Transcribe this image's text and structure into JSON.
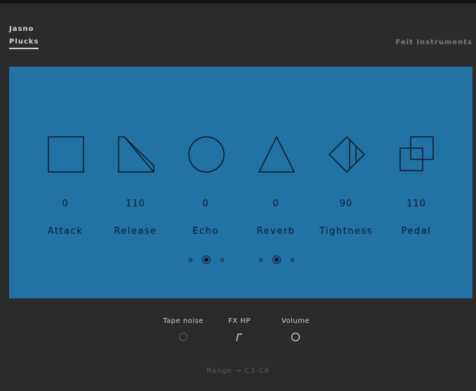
{
  "header": {
    "brand": "Jasno",
    "preset": "Plucks",
    "vendor": "Felt Instruments"
  },
  "panel": {
    "background": "#2372a6",
    "controls": [
      {
        "label": "Attack",
        "value": "0",
        "icon": "square-icon"
      },
      {
        "label": "Release",
        "value": "110",
        "icon": "release-shape-icon"
      },
      {
        "label": "Echo",
        "value": "0",
        "icon": "circle-icon"
      },
      {
        "label": "Reverb",
        "value": "0",
        "icon": "triangle-icon"
      },
      {
        "label": "Tightness",
        "value": "90",
        "icon": "diamond-icon"
      },
      {
        "label": "Pedal",
        "value": "110",
        "icon": "overlapping-squares-icon"
      }
    ],
    "pager_left": {
      "count": 3,
      "active": 1
    },
    "pager_right": {
      "count": 3,
      "active": 1
    }
  },
  "footer": {
    "tape_noise": {
      "label": "Tape noise",
      "icon": "tape-noise-knob-icon"
    },
    "fx_hp": {
      "label": "FX HP",
      "icon": "highpass-filter-icon"
    },
    "volume": {
      "label": "Volume",
      "icon": "volume-knob-icon"
    },
    "range": "Range → C3-C6"
  }
}
